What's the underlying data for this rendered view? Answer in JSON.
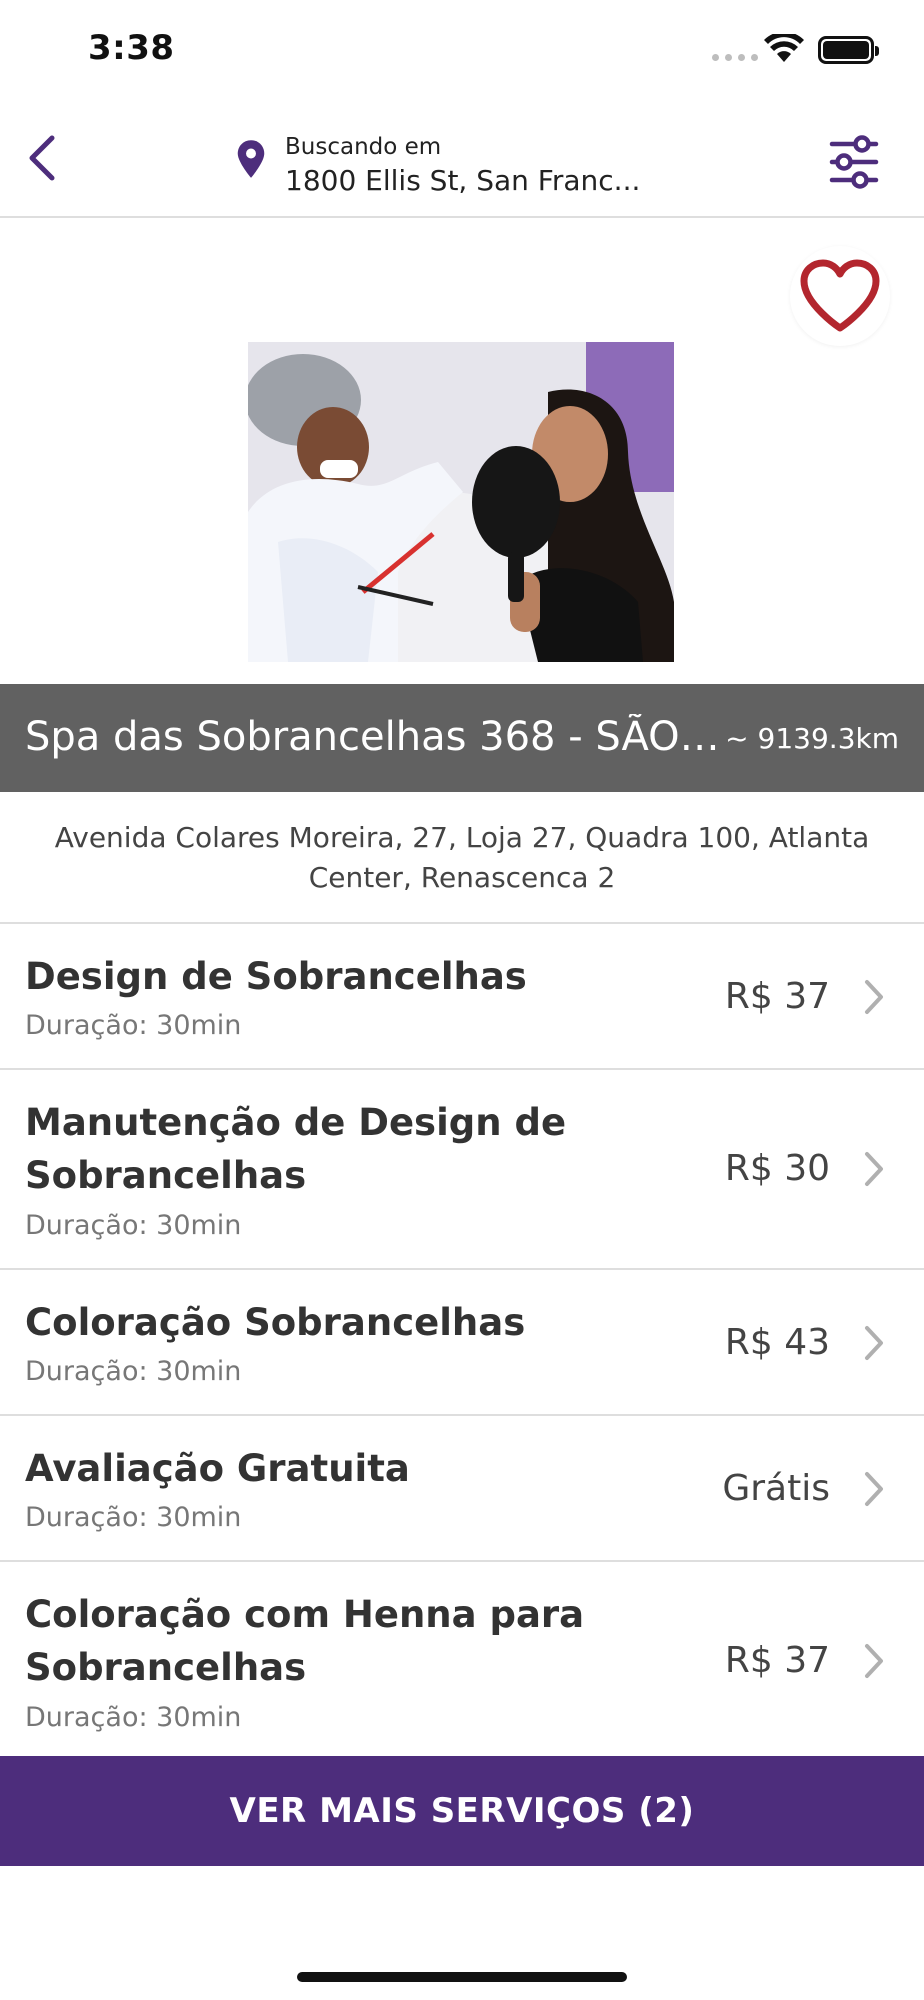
{
  "status": {
    "time": "3:38"
  },
  "nav": {
    "location_label": "Buscando em",
    "location_value": "1800 Ellis St, San Franc..."
  },
  "salon": {
    "name": "Spa das Sobrancelhas 368 - SÃO L...",
    "distance": "~ 9139.3km",
    "address": "Avenida Colares Moreira, 27, Loja 27, Quadra 100, Atlanta Center, Renascenca 2"
  },
  "services": [
    {
      "name": "Design de Sobrancelhas",
      "duration": "Duração: 30min",
      "price": "R$ 37"
    },
    {
      "name": "Manutenção de Design de Sobrancelhas",
      "duration": "Duração: 30min",
      "price": "R$ 30"
    },
    {
      "name": "Coloração Sobrancelhas",
      "duration": "Duração: 30min",
      "price": "R$ 43"
    },
    {
      "name": "Avaliação Gratuita",
      "duration": "Duração: 30min",
      "price": "Grátis"
    },
    {
      "name": "Coloração com Henna para Sobrancelhas",
      "duration": "Duração: 30min",
      "price": "R$ 37"
    }
  ],
  "more_button": "VER MAIS SERVIÇOS (2)",
  "colors": {
    "accent": "#4d2d7c",
    "heart": "#b3262e",
    "title_bar": "#616161"
  },
  "icons": [
    "back-chevron-icon",
    "location-pin-icon",
    "filter-sliders-icon",
    "heart-icon",
    "chevron-right-icon"
  ]
}
